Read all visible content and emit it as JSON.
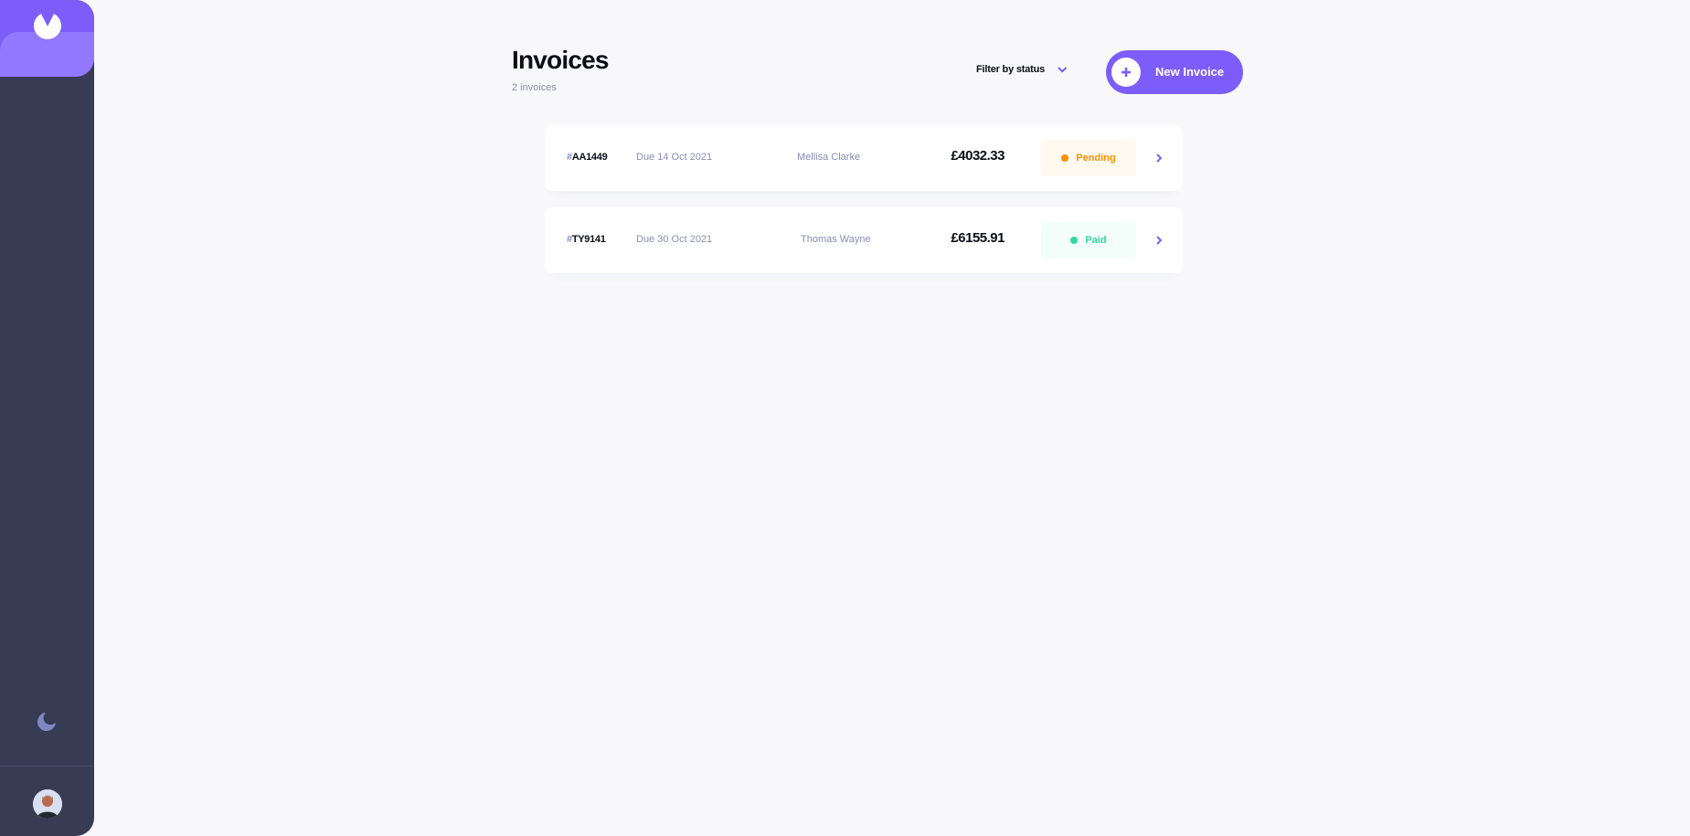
{
  "header": {
    "title": "Invoices",
    "count": "2 invoices",
    "filter_label": "Filter by status",
    "new_button_label": "New Invoice"
  },
  "invoices": [
    {
      "hash": "#",
      "id": "AA1449",
      "due": "Due 14 Oct 2021",
      "client": "Mellisa Clarke",
      "amount": "£4032.33",
      "status": "Pending"
    },
    {
      "hash": "#",
      "id": "TY9141",
      "due": "Due 30 Oct 2021",
      "client": "Thomas Wayne",
      "amount": "£6155.91",
      "status": "Paid"
    }
  ],
  "icons": {
    "logo": "logo-icon",
    "theme_toggle": "moon-icon",
    "filter_chevron": "chevron-down-icon",
    "new_button": "plus-icon",
    "row_arrow": "chevron-right-icon"
  },
  "colors": {
    "accent": "#7c5dfa",
    "accent_light": "#9277ff",
    "sidebar": "#373b53",
    "pending": "#ff8f00",
    "pending_bg": "#fff9f0",
    "paid": "#33d69f",
    "paid_bg": "#f3fdf9",
    "background": "#f8f8fb"
  }
}
